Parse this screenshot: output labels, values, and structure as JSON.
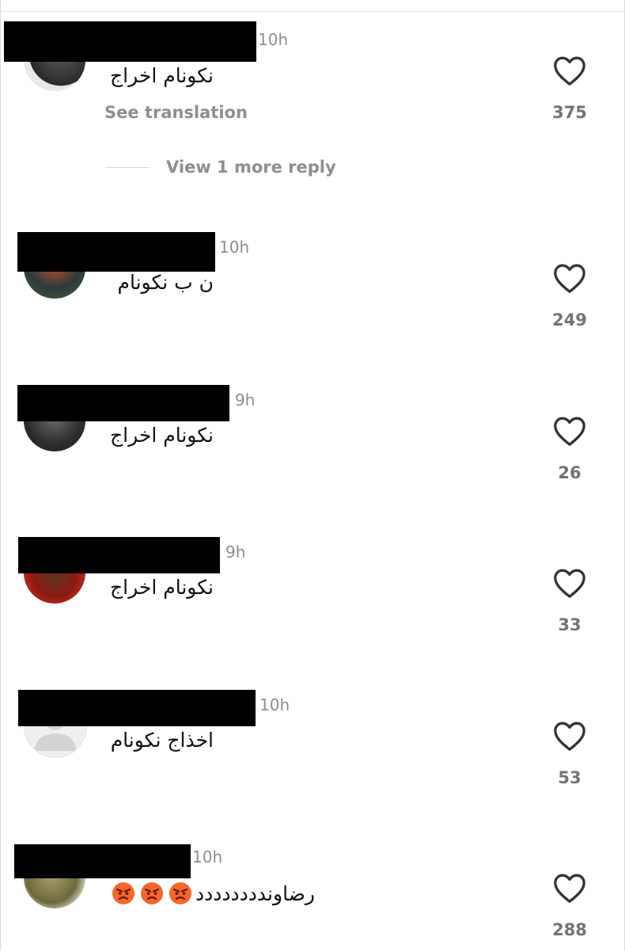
{
  "comments": [
    {
      "time": "10h",
      "text": "نکونام اخراج",
      "likes": "375",
      "see_translation": "See translation",
      "view_replies": "View 1 more reply"
    },
    {
      "time": "10h",
      "text": "ن ب نکونام",
      "likes": "249"
    },
    {
      "time": "9h",
      "text": "نکونام اخراج",
      "likes": "26"
    },
    {
      "time": "9h",
      "text": "نکونام اخراج",
      "likes": "33"
    },
    {
      "time": "10h",
      "text": "اخذاج نکونام",
      "likes": "53"
    },
    {
      "time": "10h",
      "text": "رضاوندددددددد",
      "likes": "288",
      "emojis": [
        "angry-face-icon",
        "angry-face-icon",
        "angry-face-icon"
      ]
    }
  ],
  "colors": {
    "muted": "#8e8e8e",
    "count": "#737373",
    "redaction": "#000000"
  }
}
